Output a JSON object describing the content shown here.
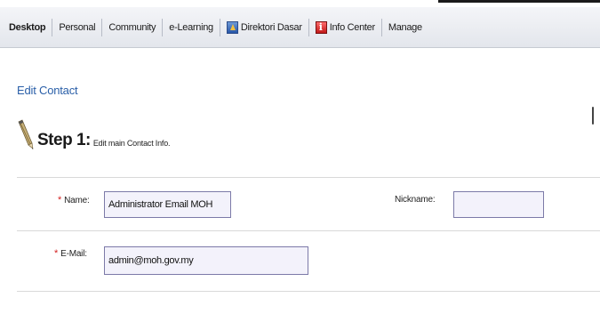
{
  "nav": {
    "items": [
      {
        "label": "Desktop"
      },
      {
        "label": "Personal"
      },
      {
        "label": "Community"
      },
      {
        "label": "e-Learning"
      },
      {
        "label": "Direktori Dasar",
        "icon": "directory-icon"
      },
      {
        "label": "Info Center",
        "icon": "info-icon"
      },
      {
        "label": "Manage"
      }
    ]
  },
  "page": {
    "title": "Edit Contact",
    "step_label": "Step 1:",
    "step_desc": "Edit main Contact Info."
  },
  "form": {
    "name_label": "Name:",
    "name_value": "Administrator Email MOH",
    "nickname_label": "Nickname:",
    "nickname_value": "",
    "email_label": "E-Mail:",
    "email_value": "admin@moh.gov.my",
    "required_marker": "*"
  },
  "colors": {
    "link_blue": "#2a5fa8",
    "required_red": "#d42020",
    "field_bg": "#f3f2fb",
    "field_border": "#7c7aa8"
  }
}
